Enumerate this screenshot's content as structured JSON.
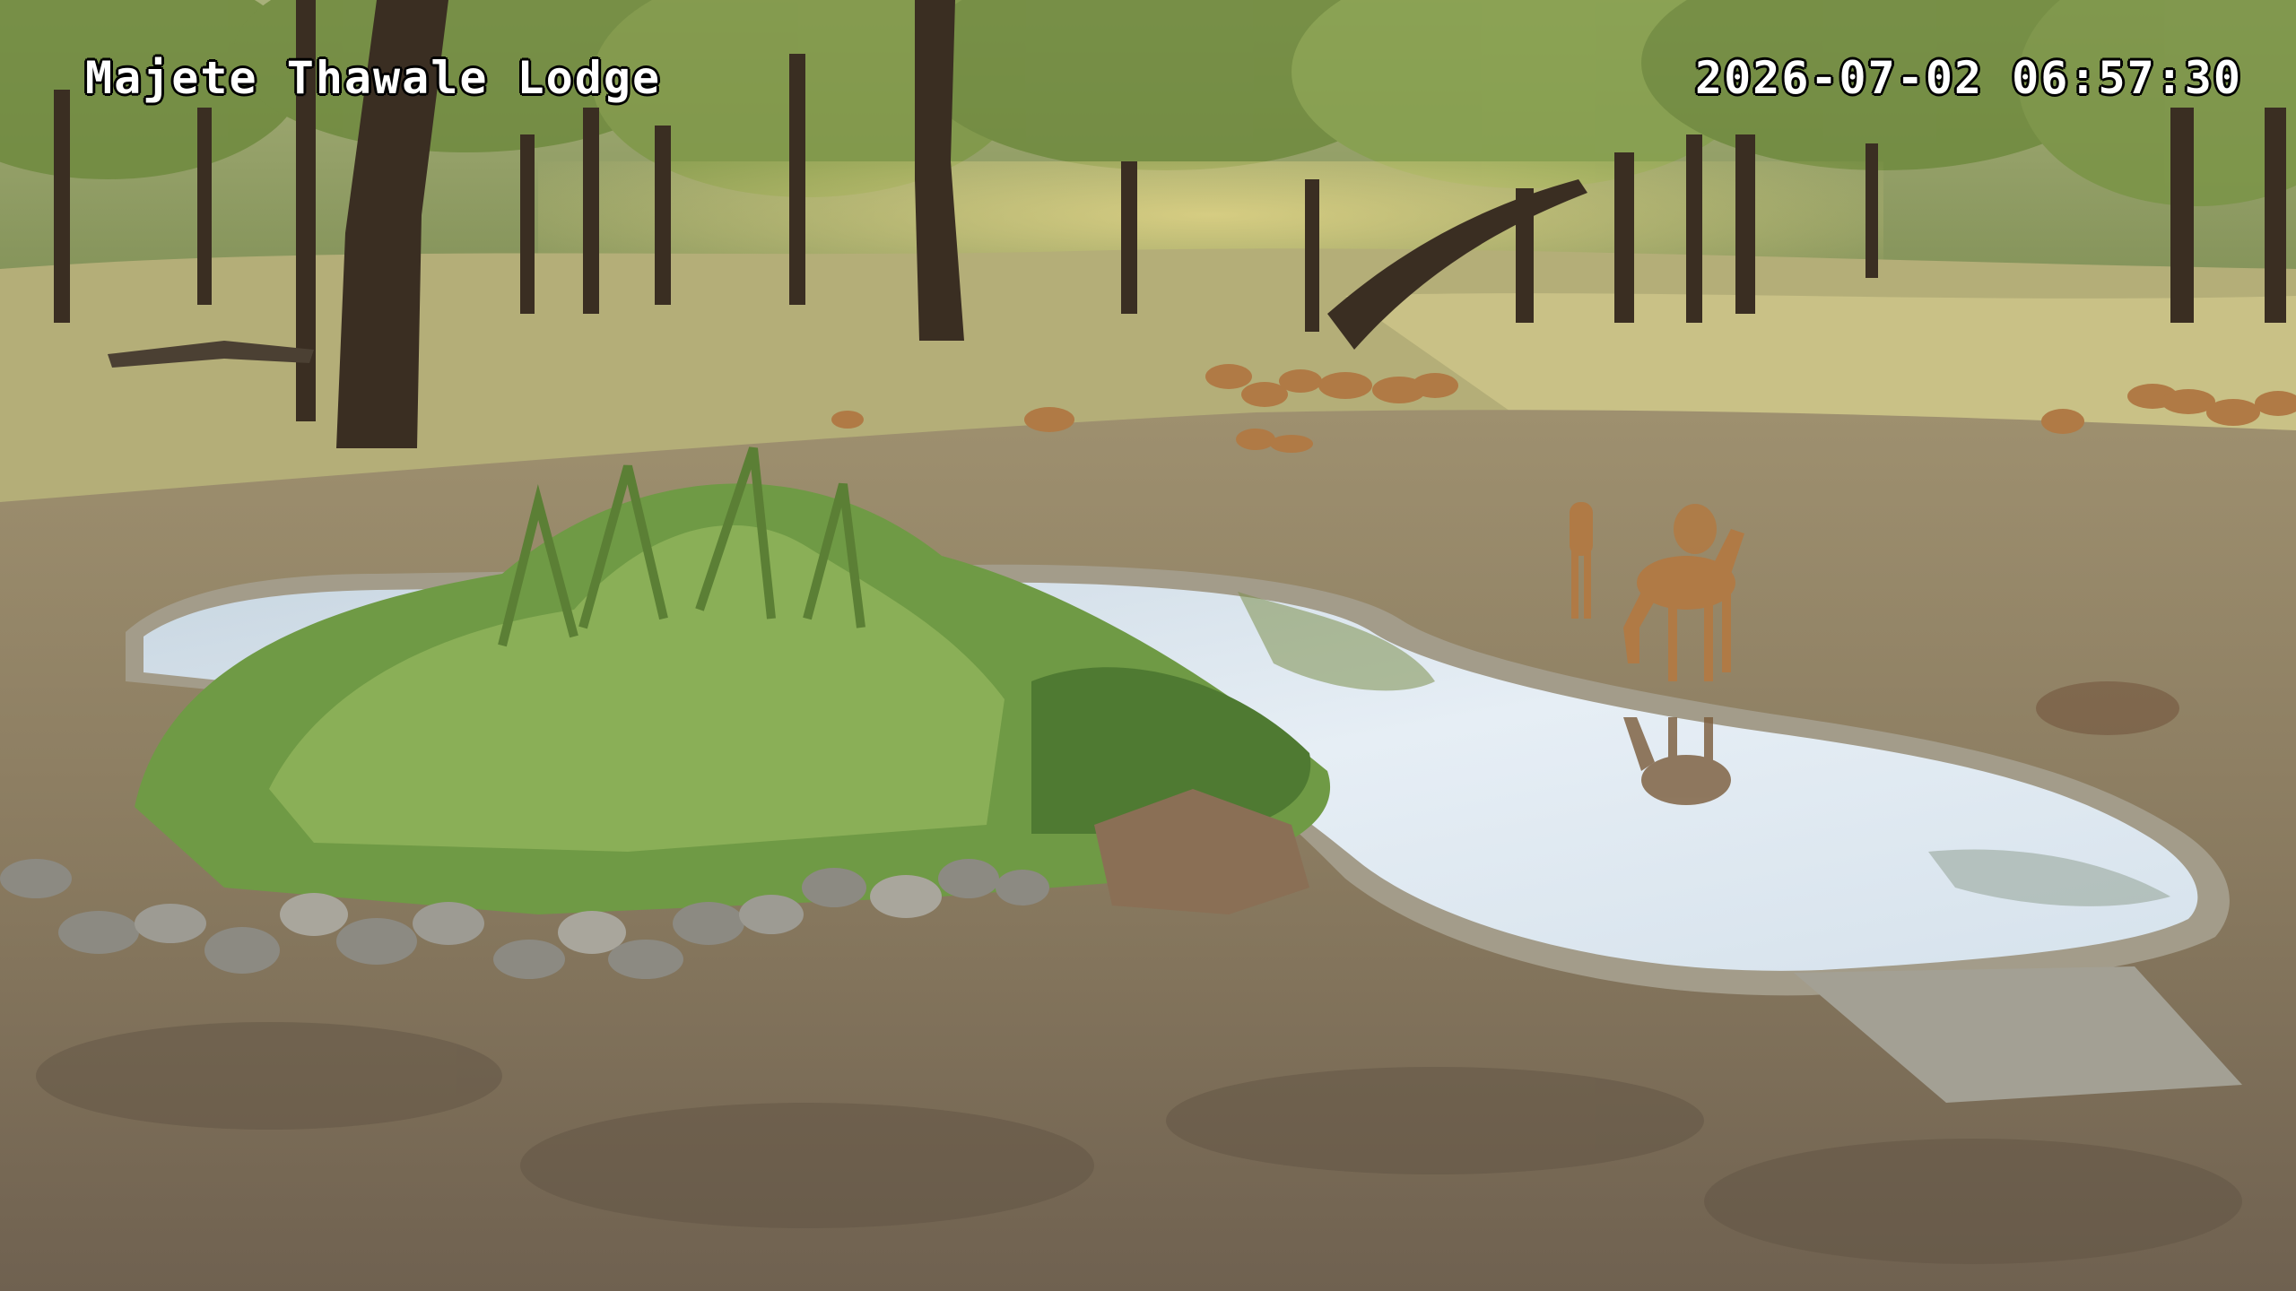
{
  "overlay": {
    "camera_label": "Majete Thawale Lodge",
    "timestamp": "2026-07-02 06:57:30"
  },
  "scene": {
    "subject": "impala-herd-at-waterhole",
    "colors": {
      "water": "#dfe9f2",
      "ground": "#8d7f64",
      "grass": "#b9b27a",
      "reeds": "#6f9a45",
      "trunk": "#3a2e22",
      "impala": "#b07a45"
    }
  }
}
